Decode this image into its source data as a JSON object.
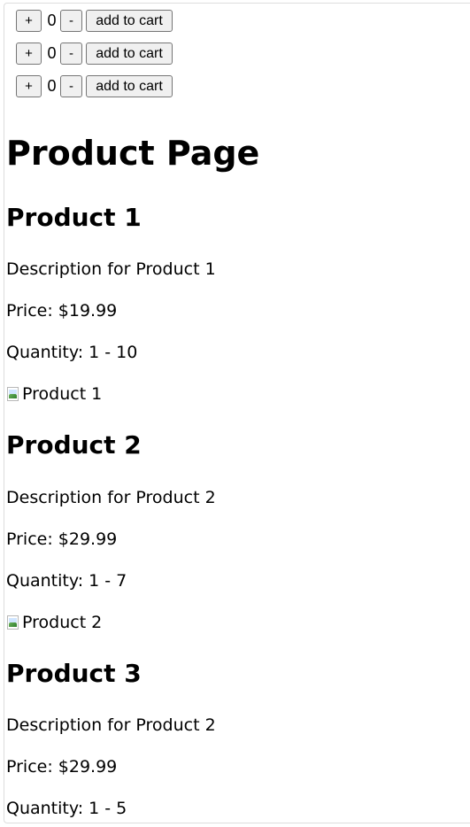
{
  "cart": {
    "rows": [
      {
        "plus": "+",
        "quantity": "0",
        "minus": "-",
        "add": "add to cart"
      },
      {
        "plus": "+",
        "quantity": "0",
        "minus": "-",
        "add": "add to cart"
      },
      {
        "plus": "+",
        "quantity": "0",
        "minus": "-",
        "add": "add to cart"
      }
    ]
  },
  "page": {
    "title": "Product Page"
  },
  "products": [
    {
      "title": "Product 1",
      "description": "Description for Product 1",
      "price": "Price: $19.99",
      "quantity": "Quantity: 1 - 10",
      "image_alt": "Product 1"
    },
    {
      "title": "Product 2",
      "description": "Description for Product 2",
      "price": "Price: $29.99",
      "quantity": "Quantity: 1 - 7",
      "image_alt": "Product 2"
    },
    {
      "title": "Product 3",
      "description": "Description for Product 2",
      "price": "Price: $29.99",
      "quantity": "Quantity: 1 - 5"
    }
  ],
  "icons": {
    "broken_image": "broken-image-icon"
  }
}
